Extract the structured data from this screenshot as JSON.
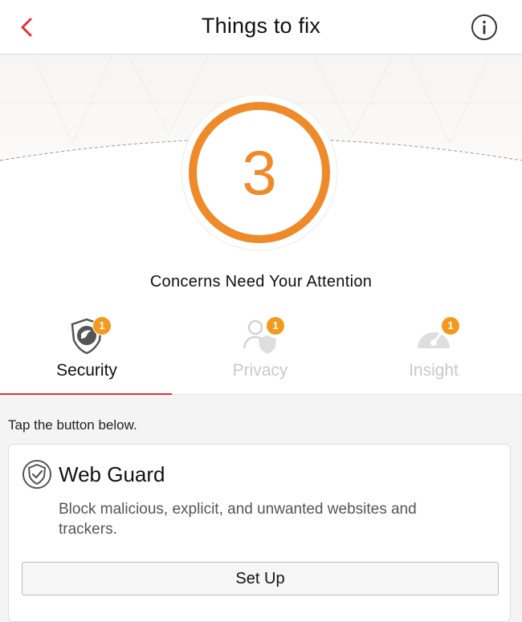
{
  "navbar": {
    "title": "Things to fix",
    "back_icon": "chevron-left-icon",
    "info_icon": "info-circle-icon",
    "accent_color": "#e0333a"
  },
  "summary": {
    "count": "3",
    "message": "Concerns Need Your Attention",
    "ring_color": "#ef8a2a"
  },
  "tabs": [
    {
      "label": "Security",
      "badge": "1",
      "icon": "shield-icon",
      "active": true
    },
    {
      "label": "Privacy",
      "badge": "1",
      "icon": "person-shield-icon",
      "active": false
    },
    {
      "label": "Insight",
      "badge": "1",
      "icon": "gauge-icon",
      "active": false
    }
  ],
  "content": {
    "hint": "Tap the button below.",
    "card": {
      "icon": "web-guard-shield-icon",
      "title": "Web Guard",
      "description": "Block malicious, explicit, and unwanted websites and trackers.",
      "button_label": "Set Up"
    }
  },
  "colors": {
    "badge": "#f39a1e",
    "active_tab_underline": "#e0333a"
  }
}
